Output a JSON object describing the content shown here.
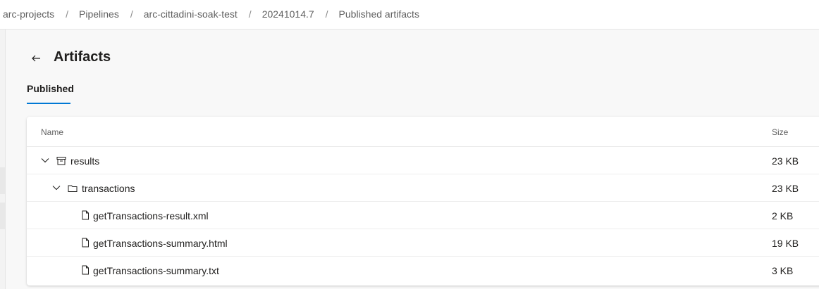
{
  "breadcrumb": [
    "arc-projects",
    "Pipelines",
    "arc-cittadini-soak-test",
    "20241014.7",
    "Published artifacts"
  ],
  "breadcrumb_separator": "/",
  "page": {
    "title": "Artifacts",
    "back_icon": "arrow-left-icon",
    "tabs": [
      {
        "label": "Published",
        "selected": true
      }
    ]
  },
  "table": {
    "columns": {
      "name": "Name",
      "size": "Size"
    },
    "rows": [
      {
        "name": "results",
        "size": "23 KB",
        "kind": "artifact",
        "icon": "archive-icon",
        "expanded": true
      },
      {
        "name": "transactions",
        "size": "23 KB",
        "kind": "folder",
        "icon": "folder-icon",
        "expanded": true
      },
      {
        "name": "getTransactions-result.xml",
        "size": "2 KB",
        "kind": "file",
        "icon": "file-icon"
      },
      {
        "name": "getTransactions-summary.html",
        "size": "19 KB",
        "kind": "file",
        "icon": "file-icon"
      },
      {
        "name": "getTransactions-summary.txt",
        "size": "3 KB",
        "kind": "file",
        "icon": "file-icon"
      }
    ]
  },
  "colors": {
    "accent": "#0078d4",
    "text": "#201f1e",
    "muted": "#5f5f5f"
  }
}
